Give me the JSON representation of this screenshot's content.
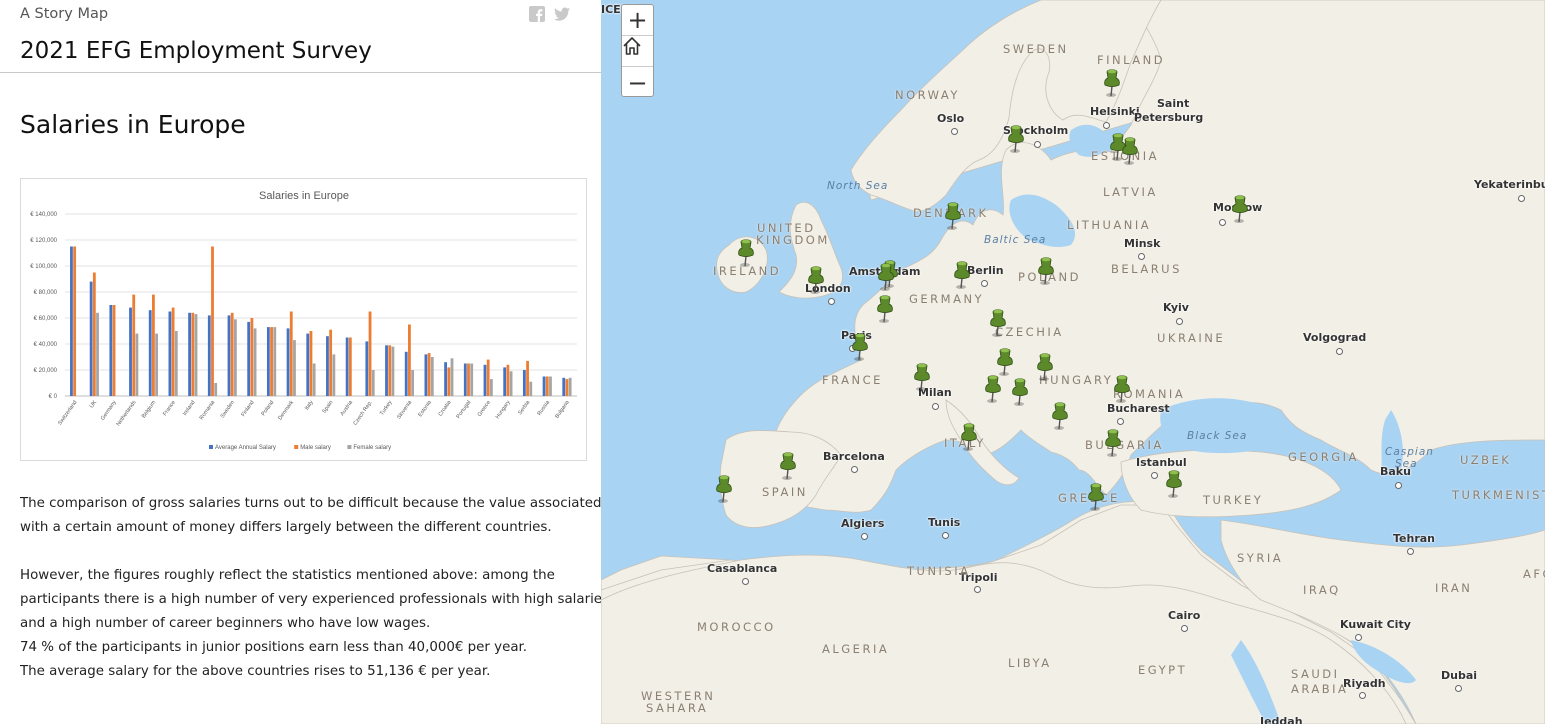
{
  "header": {
    "kicker": "A Story Map",
    "title": "2021 EFG Employment Survey",
    "share_icons": [
      "facebook-icon",
      "twitter-icon"
    ]
  },
  "section": {
    "title": "Salaries in Europe"
  },
  "chart_data": {
    "type": "bar",
    "title": "Salaries in Europe",
    "xlabel": "",
    "ylabel": "",
    "ylim": [
      0,
      140000
    ],
    "yticks": [
      "€ 0",
      "€ 20,000",
      "€ 40,000",
      "€ 60,000",
      "€ 80,000",
      "€ 100,000",
      "€ 120,000",
      "€ 140,000"
    ],
    "grid": true,
    "legend_position": "bottom",
    "categories": [
      "Switzerland",
      "UK",
      "Germany",
      "Netherlands",
      "Belgium",
      "France",
      "Ireland",
      "Romania",
      "Sweden",
      "Finland",
      "Poland",
      "Denmark",
      "Italy",
      "Spain",
      "Austria",
      "Czech Rep.",
      "Turkey",
      "Slovenia",
      "Estonia",
      "Croatia",
      "Portugal",
      "Greece",
      "Hungary",
      "Serbia",
      "Russia",
      "Bulgaria"
    ],
    "series": [
      {
        "name": "Average Annual Salary",
        "color": "#4472c4",
        "values": [
          115000,
          88000,
          70000,
          68000,
          66000,
          65000,
          64000,
          62000,
          62000,
          57000,
          53000,
          52000,
          48000,
          46000,
          45000,
          42000,
          39000,
          34000,
          32000,
          26000,
          25000,
          24000,
          22000,
          20000,
          15000,
          14000
        ]
      },
      {
        "name": "Male salary",
        "color": "#ed7d31",
        "values": [
          115000,
          95000,
          70000,
          78000,
          78000,
          68000,
          64000,
          115000,
          64000,
          60000,
          53000,
          65000,
          50000,
          51000,
          45000,
          65000,
          39000,
          55000,
          33000,
          22000,
          25000,
          28000,
          24000,
          27000,
          15000,
          13000
        ]
      },
      {
        "name": "Female salary",
        "color": "#a5a5a5",
        "values": [
          null,
          64000,
          null,
          48000,
          48000,
          50000,
          63000,
          10000,
          59000,
          52000,
          53000,
          43000,
          25000,
          32000,
          null,
          20000,
          38000,
          20000,
          30000,
          29000,
          25000,
          13000,
          19000,
          11000,
          15000,
          14000
        ]
      }
    ]
  },
  "narrative": {
    "p1_line1": "The comparison of gross salaries turns out to be difficult because the value associated",
    "p1_line2": "with a certain amount of money differs largely between the different countries.",
    "p2_line1": "However, the figures roughly reflect the statistics mentioned above: among the",
    "p2_line2": "participants there is a high number of very experienced professionals with high salaries",
    "p2_line3": "and a high number of career beginners who have low wages.",
    "p2_line4": "74 % of the participants in junior positions earn less than 40,000€ per year.",
    "p2_line5": "The average salary for the above countries rises to 51,136 € per year."
  },
  "map": {
    "controls": {
      "zoom_in": "+",
      "zoom_out": "−",
      "home_icon": "home-icon"
    },
    "cities": [
      "ICELA",
      "Oslo",
      "Stockholm",
      "Helsinki",
      "Saint",
      "Petersburg",
      "Moscow",
      "Yekaterinbu",
      "Minsk",
      "London",
      "Amsterdam",
      "Berlin",
      "Paris",
      "Kyiv",
      "Volgograd",
      "Milan",
      "Bucharest",
      "Barcelona",
      "Istanbul",
      "Baku",
      "Algiers",
      "Tunis",
      "Casablanca",
      "Tripoli",
      "Tehran",
      "Cairo",
      "Kuwait City",
      "Riyadh",
      "Dubai",
      "Jeddah"
    ],
    "countries": [
      "SWEDEN",
      "FINLAND",
      "NORWAY",
      "ESTONIA",
      "LATVIA",
      "LITHUANIA",
      "DENMARK",
      "UNITED",
      "KINGDOM",
      "IRELAND",
      "BELARUS",
      "GERMANY",
      "POLAND",
      "CZECHIA",
      "UKRAINE",
      "FRANCE",
      "HUNGARY",
      "ROMANIA",
      "ITALY",
      "BULGARIA",
      "SPAIN",
      "GREECE",
      "TURKEY",
      "GEORGIA",
      "UZBEK",
      "TURKMENISTA",
      "SYRIA",
      "IRAQ",
      "IRAN",
      "TUNISIA",
      "MOROCCO",
      "ALGERIA",
      "LIBYA",
      "EGYPT",
      "SAUDI",
      "ARABIA",
      "WESTERN",
      "SAHARA",
      "AFG"
    ],
    "seas": [
      "North Sea",
      "Baltic Sea",
      "Black Sea",
      "Caspian",
      "Sea"
    ],
    "pin_count": 29
  }
}
